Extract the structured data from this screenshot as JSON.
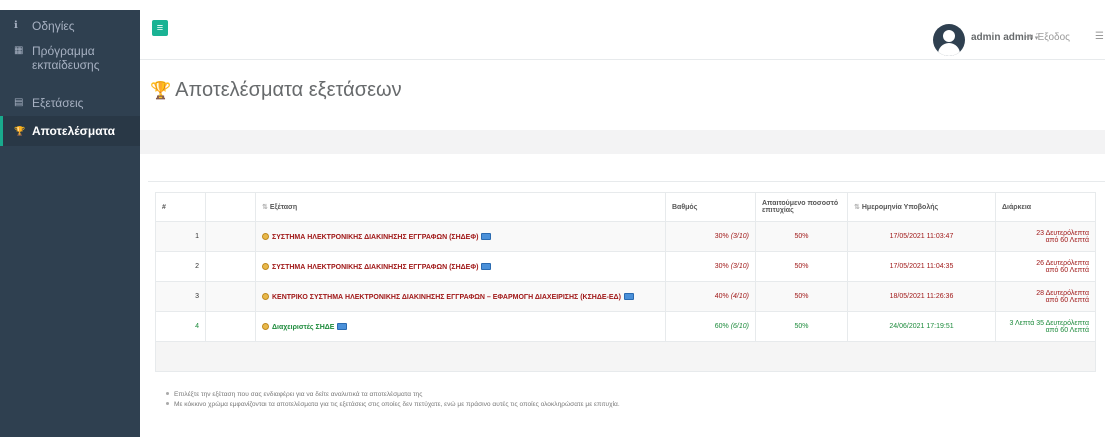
{
  "sidebar": {
    "items": [
      {
        "icon": "info-icon",
        "glyph": "ℹ",
        "label": "Οδηγίες",
        "active": false
      },
      {
        "icon": "calendar-icon",
        "glyph": "▦",
        "label": "Πρόγραμμα εκπαίδευσης",
        "active": false
      },
      {
        "icon": "file-icon",
        "glyph": "▤",
        "label": "Εξετάσεις",
        "active": false
      },
      {
        "icon": "trophy-icon",
        "glyph": "🏆",
        "label": "Αποτελέσματα",
        "active": true
      }
    ]
  },
  "topbar": {
    "menu_glyph": "≡",
    "user_name": "admin admin",
    "caret": "▾",
    "logout_glyph": "⇥",
    "logout_label": "Έξοδος",
    "more_glyph": "☰"
  },
  "page": {
    "title": "Αποτελέσματα εξετάσεων",
    "title_glyph": "🏆"
  },
  "table": {
    "headers": {
      "index": "#",
      "blank": "",
      "exam": "Εξέταση",
      "grade": "Βαθμός",
      "required": "Απαιτούμενο ποσοστό επιτυχίας",
      "date": "Ημερομηνία Υποβολής",
      "duration": "Διάρκεια"
    },
    "sort_glyph": "⇅",
    "rows": [
      {
        "index": "1",
        "exam": "ΣΥΣΤΗΜΑ ΗΛΕΚΤΡΟΝΙΚΗΣ ΔΙΑΚΙΝΗΣΗΣ ΕΓΓΡΑΦΩΝ (ΣΗΔΕΦ)",
        "grade_pct": "30%",
        "grade_frac": "(3/10)",
        "required": "50%",
        "date": "17/05/2021 11:03:47",
        "duration_line1": "23 Δευτερόλεπτα",
        "duration_line2": "από 60 Λεπτά",
        "status": "fail"
      },
      {
        "index": "2",
        "exam": "ΣΥΣΤΗΜΑ ΗΛΕΚΤΡΟΝΙΚΗΣ ΔΙΑΚΙΝΗΣΗΣ ΕΓΓΡΑΦΩΝ (ΣΗΔΕΦ)",
        "grade_pct": "30%",
        "grade_frac": "(3/10)",
        "required": "50%",
        "date": "17/05/2021 11:04:35",
        "duration_line1": "26 Δευτερόλεπτα",
        "duration_line2": "από 60 Λεπτά",
        "status": "fail"
      },
      {
        "index": "3",
        "exam": "ΚΕΝΤΡΙΚΟ ΣΥΣΤΗΜΑ ΗΛΕΚΤΡΟΝΙΚΗΣ ΔΙΑΚΙΝΗΣΗΣ ΕΓΓΡΑΦΩΝ – ΕΦΑΡΜΟΓΗ ΔΙΑΧΕΙΡΙΣΗΣ (ΚΣΗΔΕ-ΕΔ)",
        "grade_pct": "40%",
        "grade_frac": "(4/10)",
        "required": "50%",
        "date": "18/05/2021 11:26:36",
        "duration_line1": "28 Δευτερόλεπτα",
        "duration_line2": "από 60 Λεπτά",
        "status": "fail"
      },
      {
        "index": "4",
        "exam": "Διαχειριστές ΣΗΔΕ",
        "grade_pct": "60%",
        "grade_frac": "(6/10)",
        "required": "50%",
        "date": "24/06/2021 17:19:51",
        "duration_line1": "3 Λεπτά 35 Δευτερόλεπτα",
        "duration_line2": "από 60 Λεπτά",
        "status": "pass"
      }
    ]
  },
  "notes": [
    "Επιλέξτε την εξέταση που σας ενδιαφέρει για να δείτε αναλυτικά τα αποτελέσματα της",
    "Με κόκκινο χρώμα εμφανίζονται τα αποτελέσματα για τις εξετάσεις στις οποίες δεν πετύχατε, ενώ με πράσινο αυτές τις οποίες ολοκληρώσατε με επιτυχία."
  ],
  "colors": {
    "sidebar_bg": "#2f4050",
    "accent": "#1ab394",
    "fail": "#a01818",
    "pass": "#1b8a3a"
  }
}
